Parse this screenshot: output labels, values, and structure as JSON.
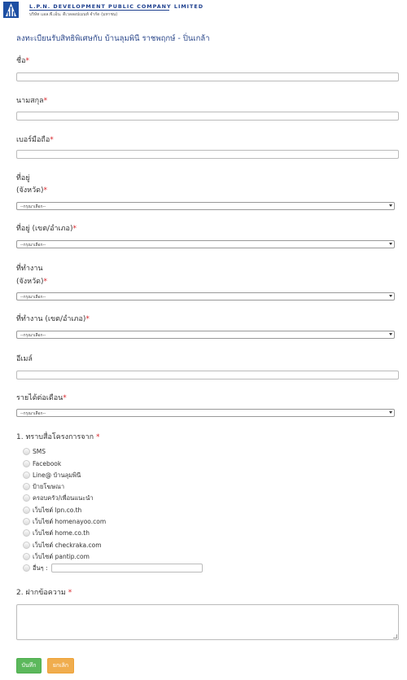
{
  "header": {
    "company_name": "L.P.N. DEVELOPMENT PUBLIC COMPANY LIMITED",
    "company_sub": "บริษัท แอล.พี.เอ็น. ดีเวลลอปเมนท์ จำกัด (มหาชน)"
  },
  "form": {
    "title": "ลงทะเบียนรับสิทธิพิเศษกับ บ้านลุมพินี ราชพฤกษ์ - ปิ่นเกล้า",
    "required_mark": "*",
    "first_name_label": "ชื่อ",
    "last_name_label": "นามสกุล",
    "phone_label": "เบอร์มือถือ",
    "address_province_label_1": "ที่อยู่",
    "address_province_label_2": "(จังหวัด)",
    "address_district_label": "ที่อยู่ (เขต/อำเภอ)",
    "work_province_label_1": "ที่ทำงาน",
    "work_province_label_2": "(จังหวัด)",
    "work_district_label": "ที่ทำงาน (เขต/อำเภอ)",
    "email_label": "อีเมล์",
    "income_label": "รายได้ต่อเดือน",
    "select_placeholder": "--กรุณาเลือก--",
    "question1_label": "1. ทราบสื่อโครงการจาก",
    "question2_label": "2. ฝากข้อความ"
  },
  "sources": [
    "SMS",
    "Facebook",
    "Line@ บ้านลุมพินี",
    "ป้ายโฆษณา",
    "ครอบครัว/เพื่อนแนะนำ",
    "เว็บไซต์ lpn.co.th",
    "เว็บไซต์ homenayoo.com",
    "เว็บไซต์ home.co.th",
    "เว็บไซต์ checkraka.com",
    "เว็บไซต์ pantip.com",
    "อื่นๆ :"
  ],
  "buttons": {
    "save": "บันทึก",
    "cancel": "ยกเลิก"
  },
  "colors": {
    "title": "#2e4a8c",
    "required": "#d9252a",
    "save_button": "#5cb85c",
    "cancel_button": "#f0ad4e"
  }
}
